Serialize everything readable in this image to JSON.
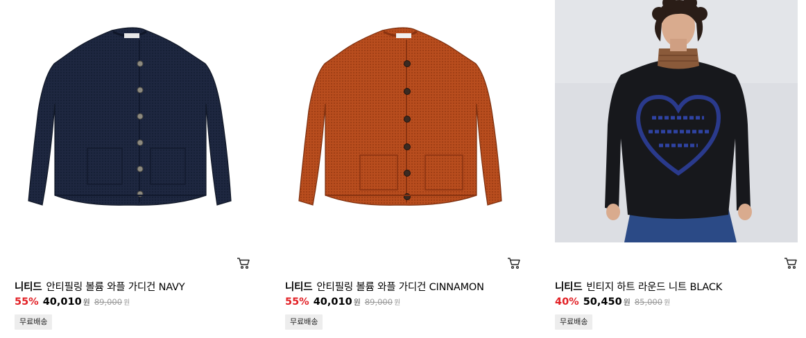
{
  "products": [
    {
      "brand": "니티드",
      "name": "안티필링 볼륨 와플 가디건 NAVY",
      "discount": "55%",
      "sale_price": "40,010",
      "currency": "원",
      "original_price": "89,000",
      "badge": "무료배송",
      "image_icon": "navy-cardigan-image",
      "color": "#1c2438"
    },
    {
      "brand": "니티드",
      "name": "안티필링 볼륨 와플 가디건 CINNAMON",
      "discount": "55%",
      "sale_price": "40,010",
      "currency": "원",
      "original_price": "89,000",
      "badge": "무료배송",
      "image_icon": "cinnamon-cardigan-image",
      "color": "#b44a1c"
    },
    {
      "brand": "니티드",
      "name": "빈티지 하트 라운드 니트 BLACK",
      "discount": "40%",
      "sale_price": "50,450",
      "currency": "원",
      "original_price": "85,000",
      "badge": "무료배송",
      "image_icon": "model-black-heart-knit-image",
      "color": "#17181c"
    }
  ],
  "icons": {
    "cart": "cart-icon"
  },
  "colors": {
    "discount": "#e22025",
    "badge_bg": "#ededed"
  }
}
